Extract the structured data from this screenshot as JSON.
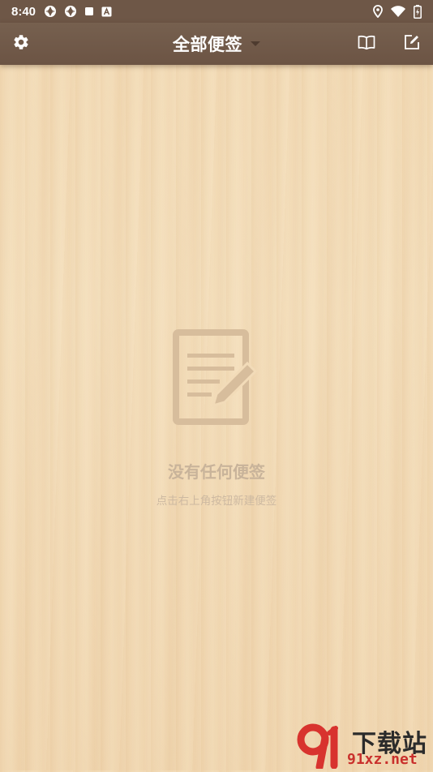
{
  "status_bar": {
    "time": "8:40",
    "left_icons": [
      "aperture-icon",
      "aperture-icon",
      "square-icon",
      "a-box-icon"
    ],
    "right_icons": [
      "location-pin-icon",
      "wifi-icon",
      "battery-charging-icon"
    ]
  },
  "app_bar": {
    "title": "全部便签",
    "left_icon": "gear-icon",
    "right_icons": [
      "book-icon",
      "edit-note-icon"
    ],
    "color": "#6e5747"
  },
  "empty_state": {
    "icon": "note-pencil-icon",
    "title": "没有任何便签",
    "subtitle": "点击右上角按钮新建便签",
    "color": "#c8b39a"
  },
  "watermark": {
    "logo": "91-logo",
    "label": "下载站",
    "url": "91xz.net"
  }
}
